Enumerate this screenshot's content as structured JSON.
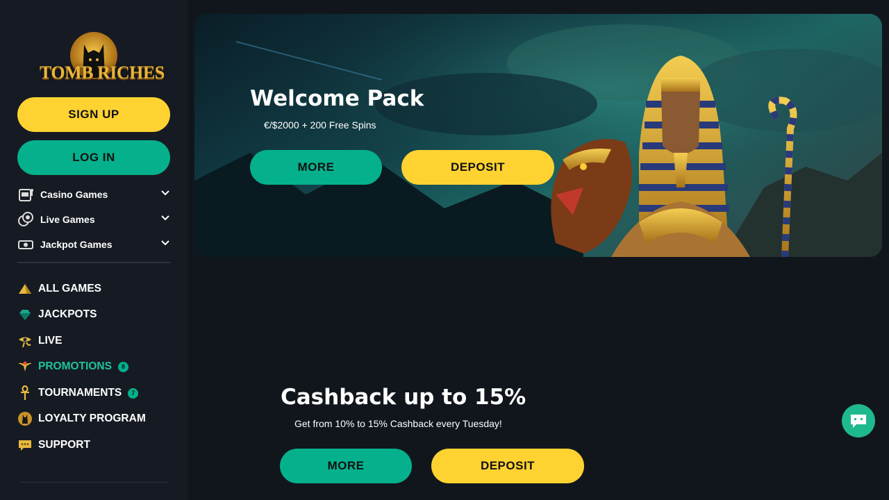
{
  "brand": {
    "logo_text": "TOMB RICHES"
  },
  "auth": {
    "signup_label": "SIGN UP",
    "login_label": "LOG IN"
  },
  "categories": [
    {
      "label": "Casino Games",
      "icon": "slot-machine-icon"
    },
    {
      "label": "Live Games",
      "icon": "chips-icon"
    },
    {
      "label": "Jackpot Games",
      "icon": "cash-icon"
    }
  ],
  "nav": [
    {
      "label": "ALL GAMES",
      "icon": "pyramid-icon"
    },
    {
      "label": "JACKPOTS",
      "icon": "gem-icon"
    },
    {
      "label": "LIVE",
      "icon": "eye-of-horus-icon"
    },
    {
      "label": "PROMOTIONS",
      "icon": "winged-scarab-icon",
      "badge": "8",
      "active": true
    },
    {
      "label": "TOURNAMENTS",
      "icon": "ankh-icon",
      "badge": "7"
    },
    {
      "label": "LOYALTY PROGRAM",
      "icon": "cat-medallion-icon"
    },
    {
      "label": "SUPPORT",
      "icon": "chat-bubble-icon"
    }
  ],
  "promos": [
    {
      "title": "Welcome Pack",
      "subtitle": "€/$2000 + 200 Free Spins",
      "more_label": "MORE",
      "deposit_label": "DEPOSIT"
    },
    {
      "title": "Cashback up to 15%",
      "subtitle": "Get from 10% to 15% Cashback every Tuesday!",
      "more_label": "MORE",
      "deposit_label": "DEPOSIT"
    }
  ],
  "colors": {
    "accent_yellow": "#fed331",
    "accent_green": "#05b18c",
    "background": "#11161d",
    "sidebar": "#161b23"
  }
}
